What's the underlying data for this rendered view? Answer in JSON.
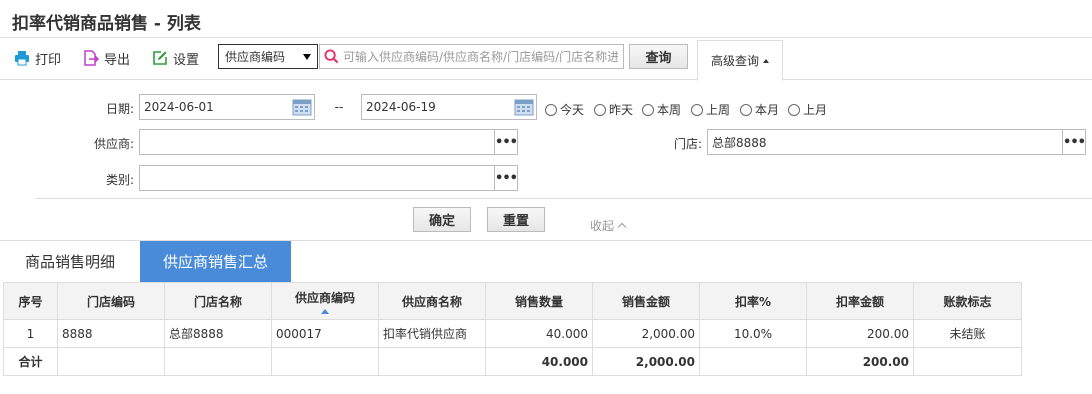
{
  "page": {
    "title": "扣率代销商品销售 - 列表"
  },
  "toolbar": {
    "print_label": "打印",
    "export_label": "导出",
    "settings_label": "设置",
    "search_field_selected": "供应商编码",
    "search_placeholder": "可输入供应商编码/供应商名称/门店编码/门店名称进行查询",
    "query_label": "查询",
    "advanced_label": "高级查询",
    "colors": {
      "print": "#1e9bd7",
      "export": "#c23ecb",
      "settings": "#2e9d3a",
      "search": "#e5336b"
    }
  },
  "filters": {
    "date_label": "日期:",
    "date_from": "2024-06-01",
    "date_sep": "--",
    "date_to": "2024-06-19",
    "quick_ranges": [
      "今天",
      "昨天",
      "本周",
      "上周",
      "本月",
      "上月"
    ],
    "supplier_label": "供应商:",
    "supplier_value": "",
    "store_label": "门店:",
    "store_value": "总部8888",
    "category_label": "类别:",
    "category_value": "",
    "confirm_label": "确定",
    "reset_label": "重置",
    "collapse_label": "收起"
  },
  "tabs": [
    {
      "label": "商品销售明细",
      "active": false
    },
    {
      "label": "供应商销售汇总",
      "active": true
    }
  ],
  "table": {
    "columns": [
      "序号",
      "门店编码",
      "门店名称",
      "供应商编码",
      "供应商名称",
      "销售数量",
      "销售金额",
      "扣率%",
      "扣率金额",
      "账款标志"
    ],
    "sorted_column": "供应商编码",
    "rows": [
      [
        "1",
        "8888",
        "总部8888",
        "000017",
        "扣率代销供应商",
        "40.000",
        "2,000.00",
        "10.0%",
        "200.00",
        "未结账"
      ]
    ],
    "footer": {
      "label": "合计",
      "qty": "40.000",
      "amount": "2,000.00",
      "rate_amount": "200.00"
    }
  }
}
